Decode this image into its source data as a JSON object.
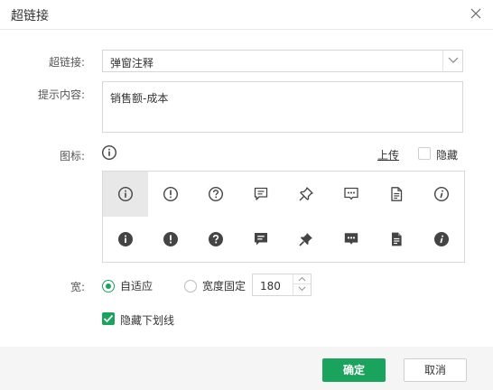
{
  "dialog": {
    "title": "超链接",
    "close_icon": "close-icon"
  },
  "form": {
    "hyperlink_label": "超链接:",
    "hyperlink_value": "弹窗注释",
    "tooltip_label": "提示内容:",
    "tooltip_value": "销售额-成本",
    "icon_label": "图标:",
    "current_icon": "info-outline-icon",
    "upload_label": "上传",
    "hide_label": "隐藏",
    "hide_checked": false,
    "width_label": "宽:",
    "width_options": [
      {
        "label": "自适应",
        "selected": true
      },
      {
        "label": "宽度固定",
        "selected": false
      }
    ],
    "width_value": "180",
    "hide_underline_label": "隐藏下划线",
    "hide_underline_checked": true
  },
  "icon_grid": {
    "selected_index": 0,
    "row1": [
      "info-outline-icon",
      "exclamation-outline-icon",
      "question-outline-icon",
      "message-outline-icon",
      "pin-outline-icon",
      "chat-dots-outline-icon",
      "document-outline-icon",
      "italic-info-outline-icon"
    ],
    "row2": [
      "info-filled-icon",
      "exclamation-filled-icon",
      "question-filled-icon",
      "message-filled-icon",
      "pin-filled-icon",
      "chat-dots-filled-icon",
      "document-filled-icon",
      "italic-info-filled-icon"
    ]
  },
  "footer": {
    "ok_label": "确定",
    "cancel_label": "取消"
  },
  "colors": {
    "accent": "#1aa35d",
    "icon": "#444444",
    "selected_cell": "#e8e8e8"
  }
}
